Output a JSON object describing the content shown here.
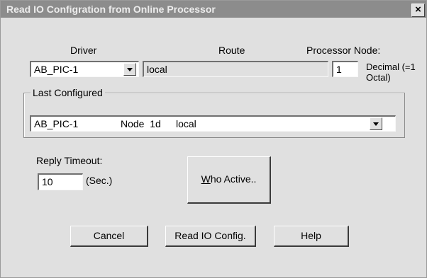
{
  "window": {
    "title": "Read IO Configration from Online Processor",
    "close_glyph": "×"
  },
  "driver": {
    "label": "Driver",
    "value": "AB_PIC-1"
  },
  "route": {
    "label": "Route",
    "value": "local"
  },
  "processor_node": {
    "label": "Processor Node:",
    "value": "1",
    "note_line1": "Decimal (=1",
    "note_line2": "Octal)"
  },
  "last_configured": {
    "label": "Last Configured",
    "driver": "AB_PIC-1",
    "node": "Node  1d",
    "route": "local"
  },
  "reply_timeout": {
    "label": "Reply Timeout:",
    "value": "10",
    "unit": "(Sec.)"
  },
  "buttons": {
    "who_active_mnemonic": "W",
    "who_active_rest": "ho Active..",
    "cancel": "Cancel",
    "read_io_config": "Read IO Config.",
    "help": "Help"
  },
  "colors": {
    "titlebar": "#8c8c8c",
    "dialog_bg": "#e0e0e0"
  }
}
